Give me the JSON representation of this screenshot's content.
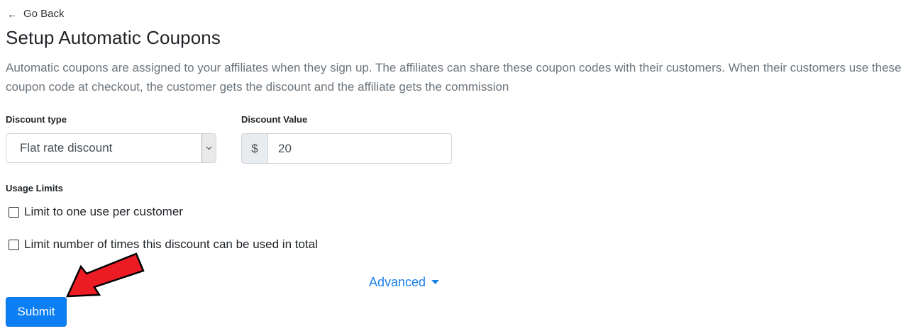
{
  "nav": {
    "back_arrow": "←",
    "back_label": "Go Back"
  },
  "page": {
    "title": "Setup Automatic Coupons",
    "description": "Automatic coupons are assigned to your affiliates when they sign up. The affiliates can share these coupon codes with their customers. When their customers use these coupon code at checkout, the customer gets the discount and the affiliate gets the commission"
  },
  "form": {
    "discount_type": {
      "label": "Discount type",
      "selected": "Flat rate discount"
    },
    "discount_value": {
      "label": "Discount Value",
      "prefix": "$",
      "value": "20"
    },
    "usage_limits": {
      "label": "Usage Limits",
      "options": [
        {
          "label": "Limit to one use per customer",
          "checked": false
        },
        {
          "label": "Limit number of times this discount can be used in total",
          "checked": false
        }
      ]
    },
    "advanced_label": "Advanced",
    "submit_label": "Submit"
  },
  "colors": {
    "primary": "#0d7ff5",
    "link": "#1a7fe6",
    "annotation_arrow": "#ed1c24",
    "muted_text": "#6c757d"
  },
  "icons": {
    "back": "left-arrow-icon",
    "select_toggle": "chevron-down-icon",
    "advanced_toggle": "caret-down-icon",
    "annotation": "red-pointer-arrow"
  }
}
